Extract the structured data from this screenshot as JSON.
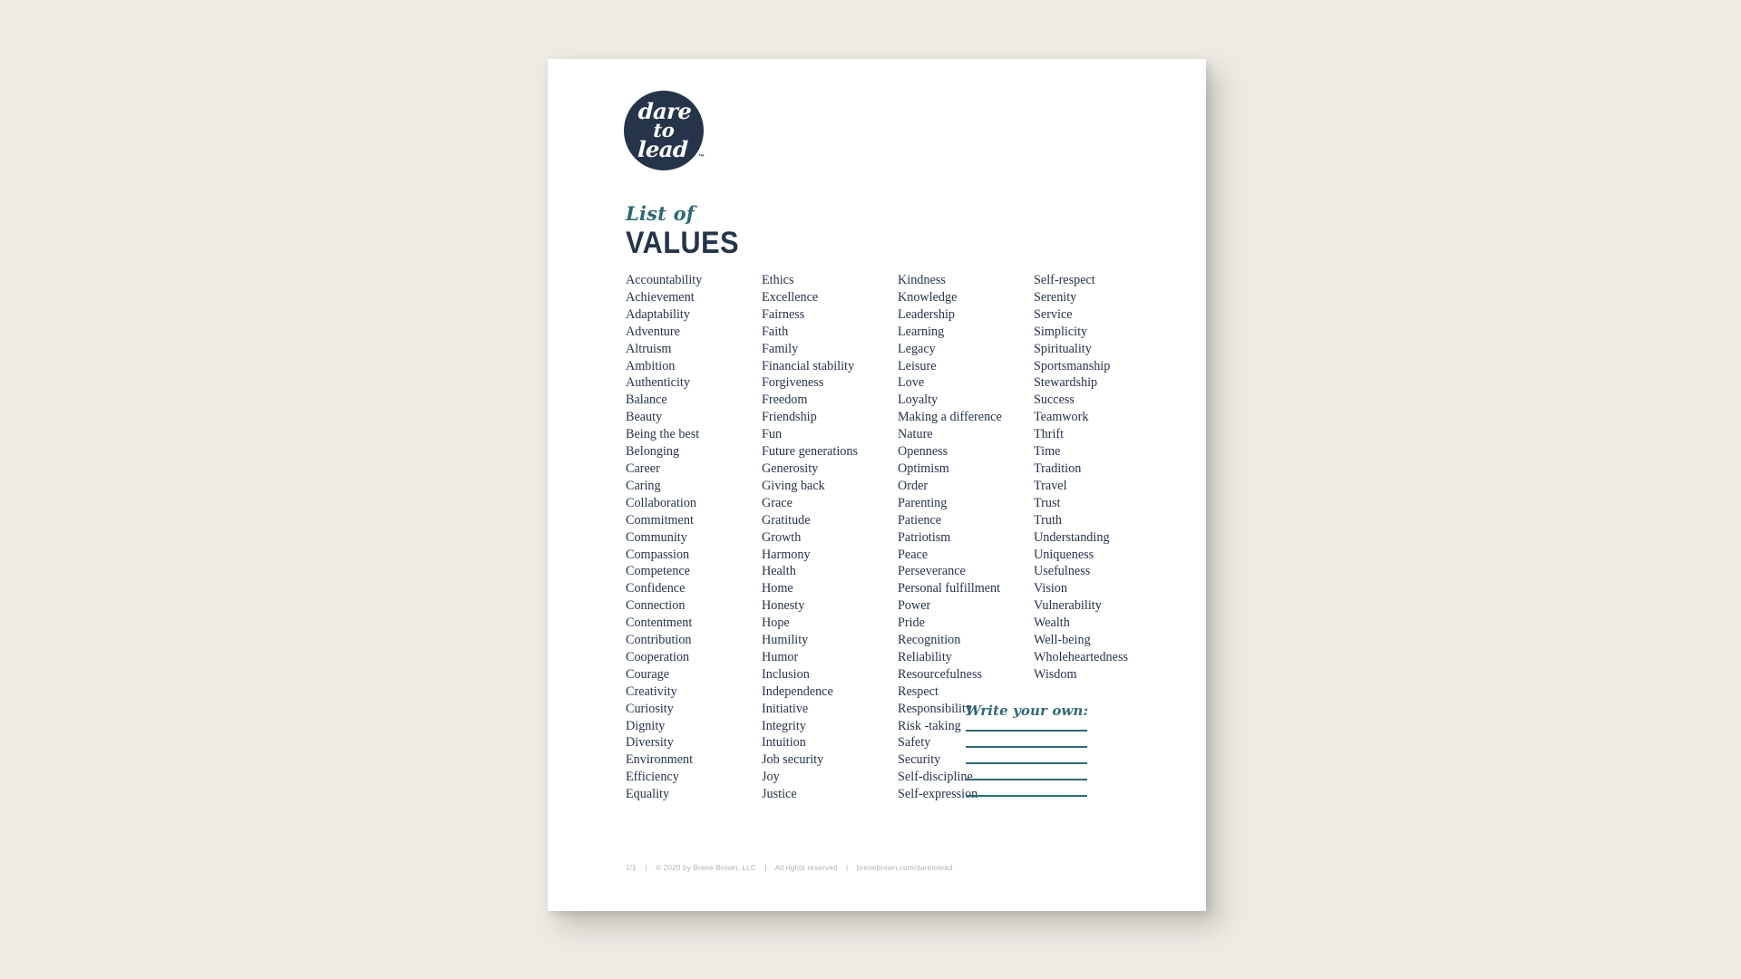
{
  "document": {
    "brand_logo": {
      "line1": "dare",
      "line2": "to",
      "line3": "lead",
      "trademark": "™"
    },
    "title": {
      "kicker": "List of",
      "main": "VALUES"
    },
    "columns": [
      {
        "id": "column-1",
        "items": [
          "Accountability",
          "Achievement",
          "Adaptability",
          "Adventure",
          "Altruism",
          "Ambition",
          "Authenticity",
          "Balance",
          "Beauty",
          "Being the best",
          "Belonging",
          "Career",
          "Caring",
          "Collaboration",
          "Commitment",
          "Community",
          "Compassion",
          "Competence",
          "Confidence",
          "Connection",
          "Contentment",
          "Contribution",
          "Cooperation",
          "Courage",
          "Creativity",
          "Curiosity",
          "Dignity",
          "Diversity",
          "Environment",
          "Efficiency",
          "Equality"
        ]
      },
      {
        "id": "column-2",
        "items": [
          "Ethics",
          "Excellence",
          "Fairness",
          "Faith",
          "Family",
          "Financial stability",
          "Forgiveness",
          "Freedom",
          "Friendship",
          "Fun",
          "Future generations",
          "Generosity",
          "Giving back",
          "Grace",
          "Gratitude",
          "Growth",
          "Harmony",
          "Health",
          "Home",
          "Honesty",
          "Hope",
          "Humility",
          "Humor",
          "Inclusion",
          "Independence",
          "Initiative",
          "Integrity",
          "Intuition",
          "Job security",
          "Joy",
          "Justice"
        ]
      },
      {
        "id": "column-3",
        "items": [
          "Kindness",
          "Knowledge",
          "Leadership",
          "Learning",
          "Legacy",
          "Leisure",
          "Love",
          "Loyalty",
          "Making a difference",
          "Nature",
          "Openness",
          "Optimism",
          "Order",
          "Parenting",
          "Patience",
          "Patriotism",
          "Peace",
          "Perseverance",
          "Personal fulfillment",
          "Power",
          "Pride",
          "Recognition",
          "Reliability",
          "Resourcefulness",
          "Respect",
          "Responsibility",
          "Risk -taking",
          "Safety",
          "Security",
          "Self-discipline",
          "Self-expression"
        ]
      },
      {
        "id": "column-4",
        "items": [
          "Self-respect",
          "Serenity",
          "Service",
          "Simplicity",
          "Spirituality",
          "Sportsmanship",
          "Stewardship",
          "Success",
          "Teamwork",
          "Thrift",
          "Time",
          "Tradition",
          "Travel",
          "Trust",
          "Truth",
          "Understanding",
          "Uniqueness",
          "Usefulness",
          "Vision",
          "Vulnerability",
          "Wealth",
          "Well-being",
          "Wholeheartedness",
          "Wisdom"
        ]
      }
    ],
    "write_your_own": {
      "label": "Write your own:",
      "line_count": 5
    },
    "footer": {
      "page": "1/1",
      "copyright": "© 2020 by Brené Brown, LLC",
      "rights": "All rights reserved",
      "website": "brenebrown.com/daretolead",
      "separator": "|"
    },
    "colors": {
      "page_background": "#eceae3",
      "sheet": "#ffffff",
      "navy": "#26344a",
      "teal": "#2e6a73",
      "footer_grey": "#b4b2ab"
    }
  }
}
